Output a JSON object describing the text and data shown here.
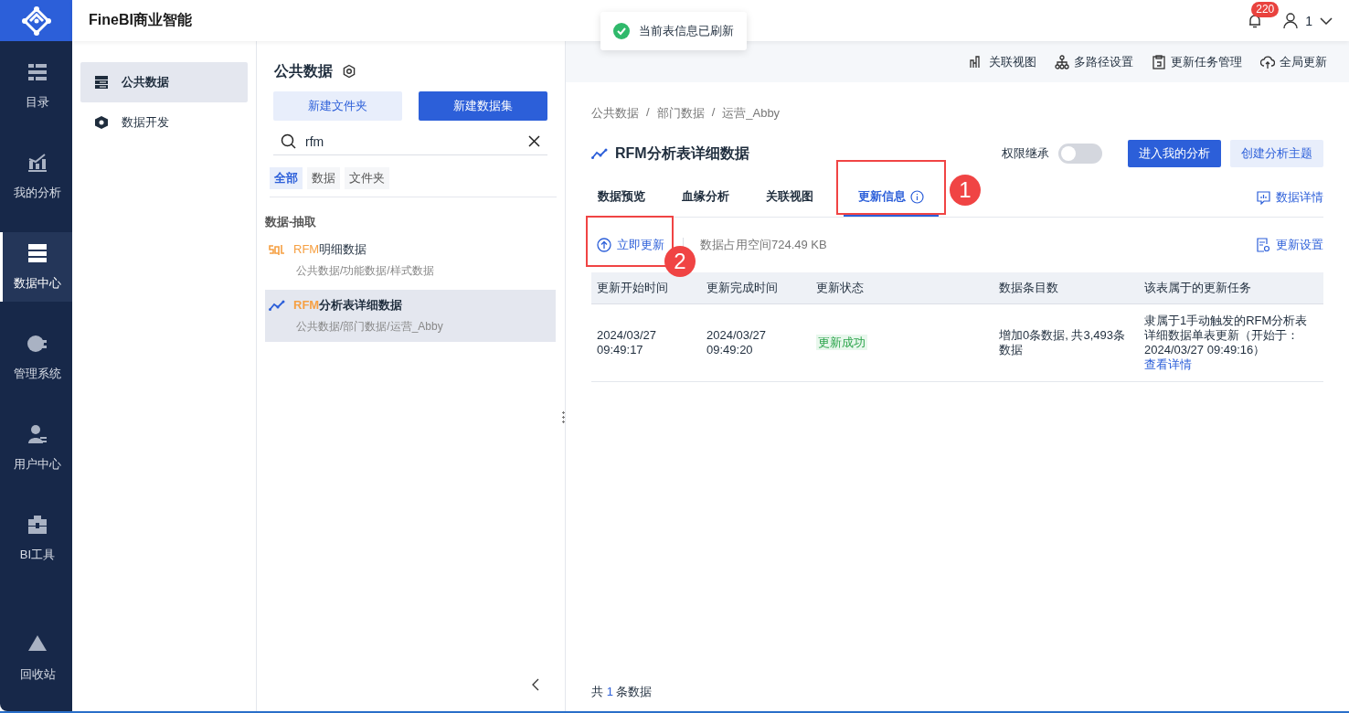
{
  "app": {
    "title": "FineBI商业智能"
  },
  "header": {
    "notification_count": "220",
    "user": "1"
  },
  "toast": {
    "message": "当前表信息已刷新"
  },
  "nav": [
    {
      "label": "目录",
      "selected": false
    },
    {
      "label": "我的分析",
      "selected": false
    },
    {
      "label": "数据中心",
      "selected": true
    },
    {
      "label": "管理系统",
      "selected": false
    },
    {
      "label": "用户中心",
      "selected": false
    },
    {
      "label": "BI工具",
      "selected": false
    },
    {
      "label": "回收站",
      "selected": false
    }
  ],
  "subnav": [
    {
      "label": "公共数据",
      "selected": true
    },
    {
      "label": "数据开发",
      "selected": false
    }
  ],
  "panel": {
    "title": "公共数据",
    "buttons": [
      {
        "label": "新建文件夹",
        "kind": "secondary"
      },
      {
        "label": "新建数据集",
        "kind": "primary"
      }
    ],
    "search": {
      "value": "rfm"
    },
    "filters": [
      {
        "label": "全部",
        "selected": true
      },
      {
        "label": "数据",
        "selected": false
      },
      {
        "label": "文件夹",
        "selected": false
      }
    ],
    "group": "数据-抽取",
    "items": [
      {
        "match": "RFM",
        "rest": "明细数据",
        "path": "公共数据/功能数据/样式数据",
        "selected": false
      },
      {
        "match": "RFM",
        "rest": "分析表详细数据",
        "path": "公共数据/部门数据/运营_Abby",
        "selected": true
      }
    ]
  },
  "toolbar": [
    "关联视图",
    "多路径设置",
    "更新任务管理",
    "全局更新"
  ],
  "breadcrumb": {
    "separator": "/",
    "items": [
      "公共数据",
      "部门数据",
      "运营_Abby"
    ]
  },
  "dataset": {
    "title": "RFM分析表详细数据",
    "inherit_label": "权限继承",
    "inherit_on": false,
    "actions": [
      {
        "label": "进入我的分析",
        "kind": "primary"
      },
      {
        "label": "创建分析主题",
        "kind": "secondary"
      }
    ]
  },
  "tabs": [
    {
      "label": "数据预览",
      "selected": false
    },
    {
      "label": "血缘分析",
      "selected": false
    },
    {
      "label": "关联视图",
      "selected": false
    },
    {
      "label": "更新信息",
      "selected": true,
      "info": true,
      "callout": "1"
    }
  ],
  "detail_link": "数据详情",
  "update": {
    "button": "立即更新",
    "callout": "2",
    "space": "数据占用空间724.49 KB",
    "settings": "更新设置"
  },
  "table": {
    "columns": [
      "更新开始时间",
      "更新完成时间",
      "更新状态",
      "数据条目数",
      "该表属于的更新任务"
    ],
    "rows": [
      {
        "start": "2024/03/27\n09:49:17",
        "end": "2024/03/27\n09:49:20",
        "status": "更新成功",
        "count": "增加0条数据, 共3,493条数据",
        "task": "隶属于1手动触发的RFM分析表详细数据单表更新（开始于：2024/03/27 09:49:16）",
        "task_link": "查看详情"
      }
    ]
  },
  "footer": {
    "prefix": "共",
    "count": "1",
    "suffix": "条数据"
  }
}
